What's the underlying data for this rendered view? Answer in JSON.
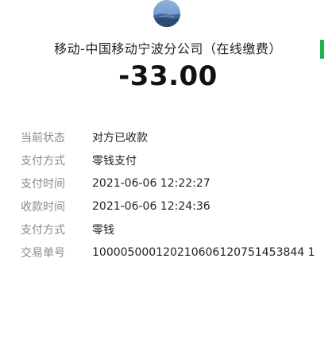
{
  "header": {
    "avatar_icon": "landscape-avatar-icon",
    "merchant": "移动-中国移动宁波分公司（在线缴费）",
    "amount": "-33.00"
  },
  "details": [
    {
      "label": "当前状态",
      "value": "对方已收款"
    },
    {
      "label": "支付方式",
      "value": "零钱支付"
    },
    {
      "label": "支付时间",
      "value": "2021-06-06 12:22:27"
    },
    {
      "label": "收款时间",
      "value": "2021-06-06 12:24:36"
    },
    {
      "label": "支付方式",
      "value": "零钱"
    },
    {
      "label": "交易单号",
      "value": "100005000120210606120751453844 1"
    }
  ],
  "colors": {
    "edge_accent": "#20b24a"
  }
}
